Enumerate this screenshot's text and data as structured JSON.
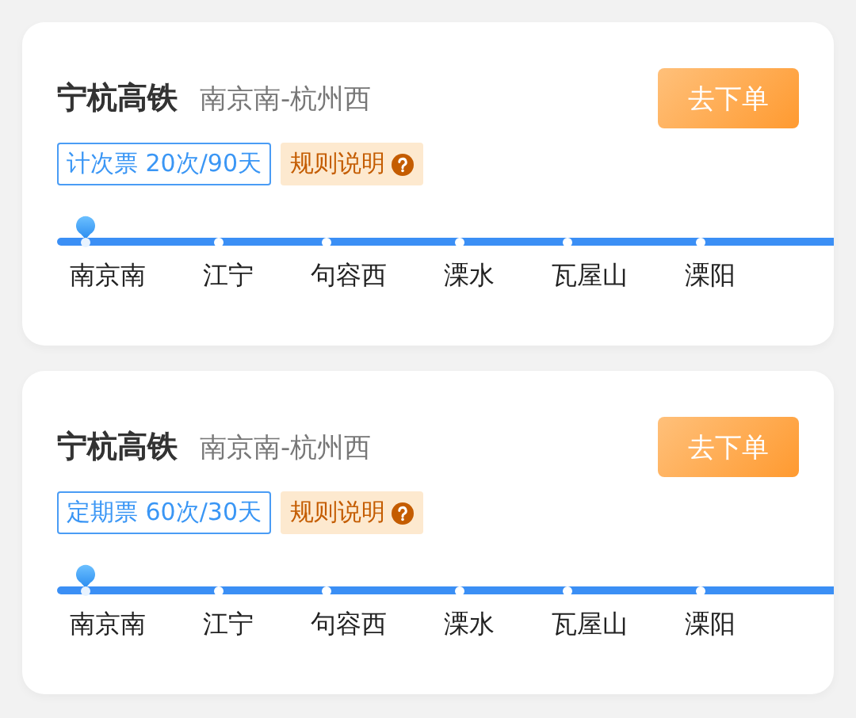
{
  "cards": [
    {
      "title": "宁杭高铁",
      "route": "南京南-杭州西",
      "button": "去下单",
      "ticket": "计次票 20次/90天",
      "rules": "规则说明",
      "stations": [
        {
          "name": "南京南",
          "selected": true
        },
        {
          "name": "江宁",
          "selected": false
        },
        {
          "name": "句容西",
          "selected": false
        },
        {
          "name": "溧水",
          "selected": false
        },
        {
          "name": "瓦屋山",
          "selected": false
        },
        {
          "name": "溧阳",
          "selected": false
        }
      ]
    },
    {
      "title": "宁杭高铁",
      "route": "南京南-杭州西",
      "button": "去下单",
      "ticket": "定期票 60次/30天",
      "rules": "规则说明",
      "stations": [
        {
          "name": "南京南",
          "selected": true
        },
        {
          "name": "江宁",
          "selected": false
        },
        {
          "name": "句容西",
          "selected": false
        },
        {
          "name": "溧水",
          "selected": false
        },
        {
          "name": "瓦屋山",
          "selected": false
        },
        {
          "name": "溧阳",
          "selected": false
        }
      ]
    }
  ]
}
